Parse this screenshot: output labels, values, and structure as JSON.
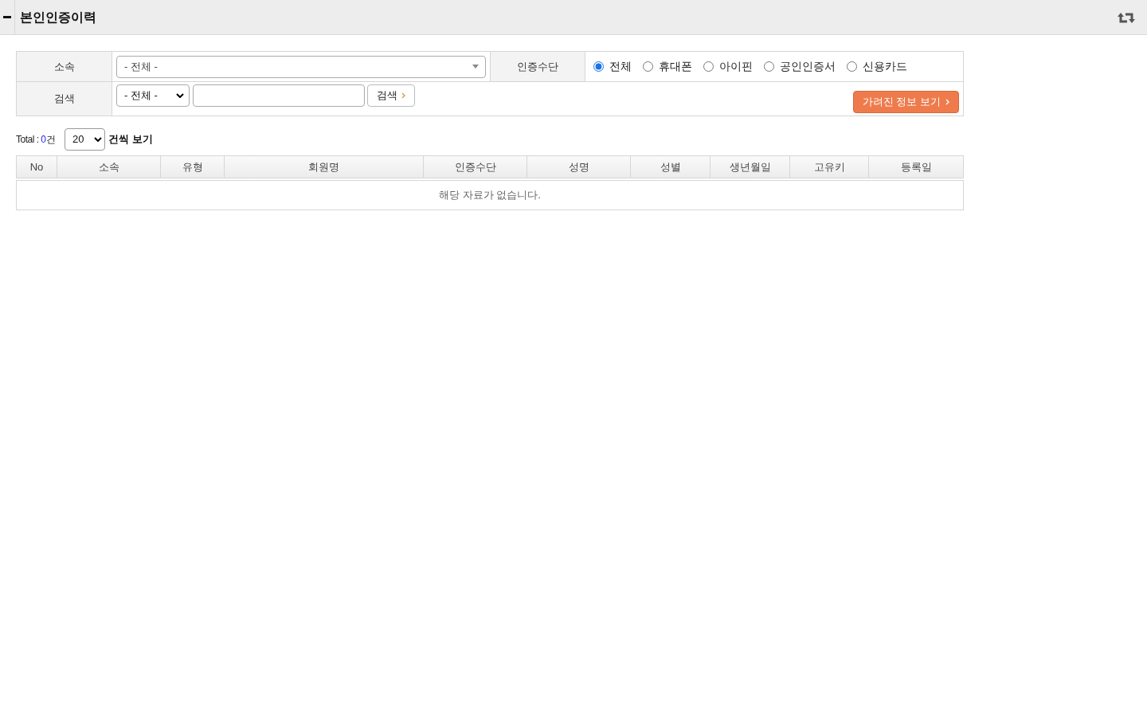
{
  "header": {
    "title": "본인인증이력"
  },
  "filters": {
    "affiliation": {
      "label": "소속",
      "value": "- 전체 -"
    },
    "auth_method": {
      "label": "인증수단",
      "options": [
        {
          "label": "전체",
          "selected": true
        },
        {
          "label": "휴대폰",
          "selected": false
        },
        {
          "label": "아이핀",
          "selected": false
        },
        {
          "label": "공인인증서",
          "selected": false
        },
        {
          "label": "신용카드",
          "selected": false
        }
      ]
    },
    "search": {
      "label": "검색",
      "field": "- 전체 -",
      "button": "검색"
    },
    "hidden_info_button": "가려진 정보 보기"
  },
  "list_info": {
    "total_label": "Total : ",
    "count": "0",
    "count_unit": "건",
    "page_size": "20",
    "page_size_label": "건씩 보기"
  },
  "table": {
    "columns": [
      "No",
      "소속",
      "유형",
      "회원명",
      "인증수단",
      "성명",
      "성별",
      "생년월일",
      "고유키",
      "등록일"
    ],
    "empty_message": "해당 자료가 없습니다."
  }
}
